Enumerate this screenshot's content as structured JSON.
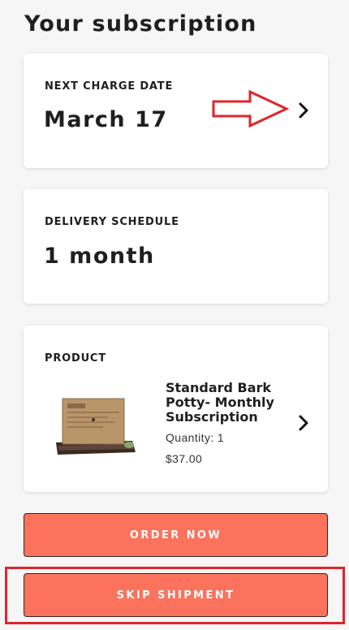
{
  "page": {
    "title": "Your subscription"
  },
  "next_charge": {
    "label": "NEXT CHARGE DATE",
    "value": "March 17"
  },
  "delivery": {
    "label": "DELIVERY SCHEDULE",
    "value": "1 month"
  },
  "product": {
    "label": "PRODUCT",
    "name": "Standard Bark Potty- Monthly Subscription",
    "quantity": "Quantity: 1",
    "price": "$37.00"
  },
  "actions": {
    "order_now": "ORDER NOW",
    "skip_shipment": "SKIP SHIPMENT"
  },
  "colors": {
    "button": "#fb735d",
    "annotation": "#e0242c",
    "background": "#f6f6f6"
  },
  "icons": [
    "chevron-right-icon",
    "arrow-right-icon"
  ]
}
